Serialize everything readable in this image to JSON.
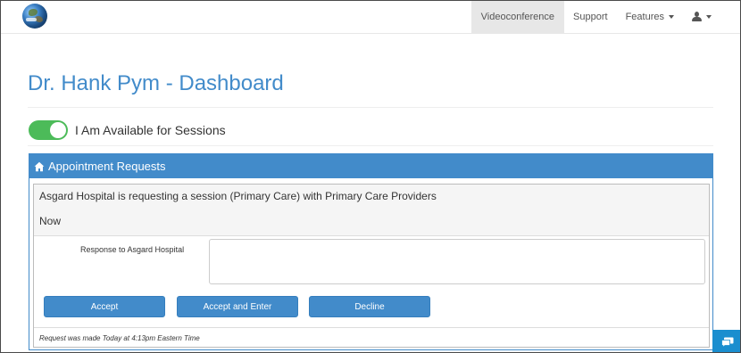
{
  "nav": {
    "items": [
      {
        "label": "Videoconference",
        "active": true
      },
      {
        "label": "Support"
      },
      {
        "label": "Features"
      }
    ],
    "user_icon": "user-icon"
  },
  "page": {
    "title": "Dr. Hank Pym - Dashboard"
  },
  "availability": {
    "label": "I Am Available for Sessions",
    "enabled": true,
    "toggle_color": "#4cbb59"
  },
  "panel": {
    "heading": "Appointment Requests",
    "heading_icon": "home-icon",
    "accent": "#428bca",
    "request": {
      "description": "Asgard Hospital is requesting a session (Primary Care) with Primary Care Providers",
      "time": "Now",
      "response_label": "Response to Asgard Hospital",
      "response_value": "",
      "buttons": {
        "accept": "Accept",
        "accept_enter": "Accept and Enter",
        "decline": "Decline"
      },
      "footer": "Request was made Today at 4:13pm Eastern Time"
    }
  },
  "chat": {
    "icon": "chat-icon",
    "color": "#1a8ecf"
  }
}
